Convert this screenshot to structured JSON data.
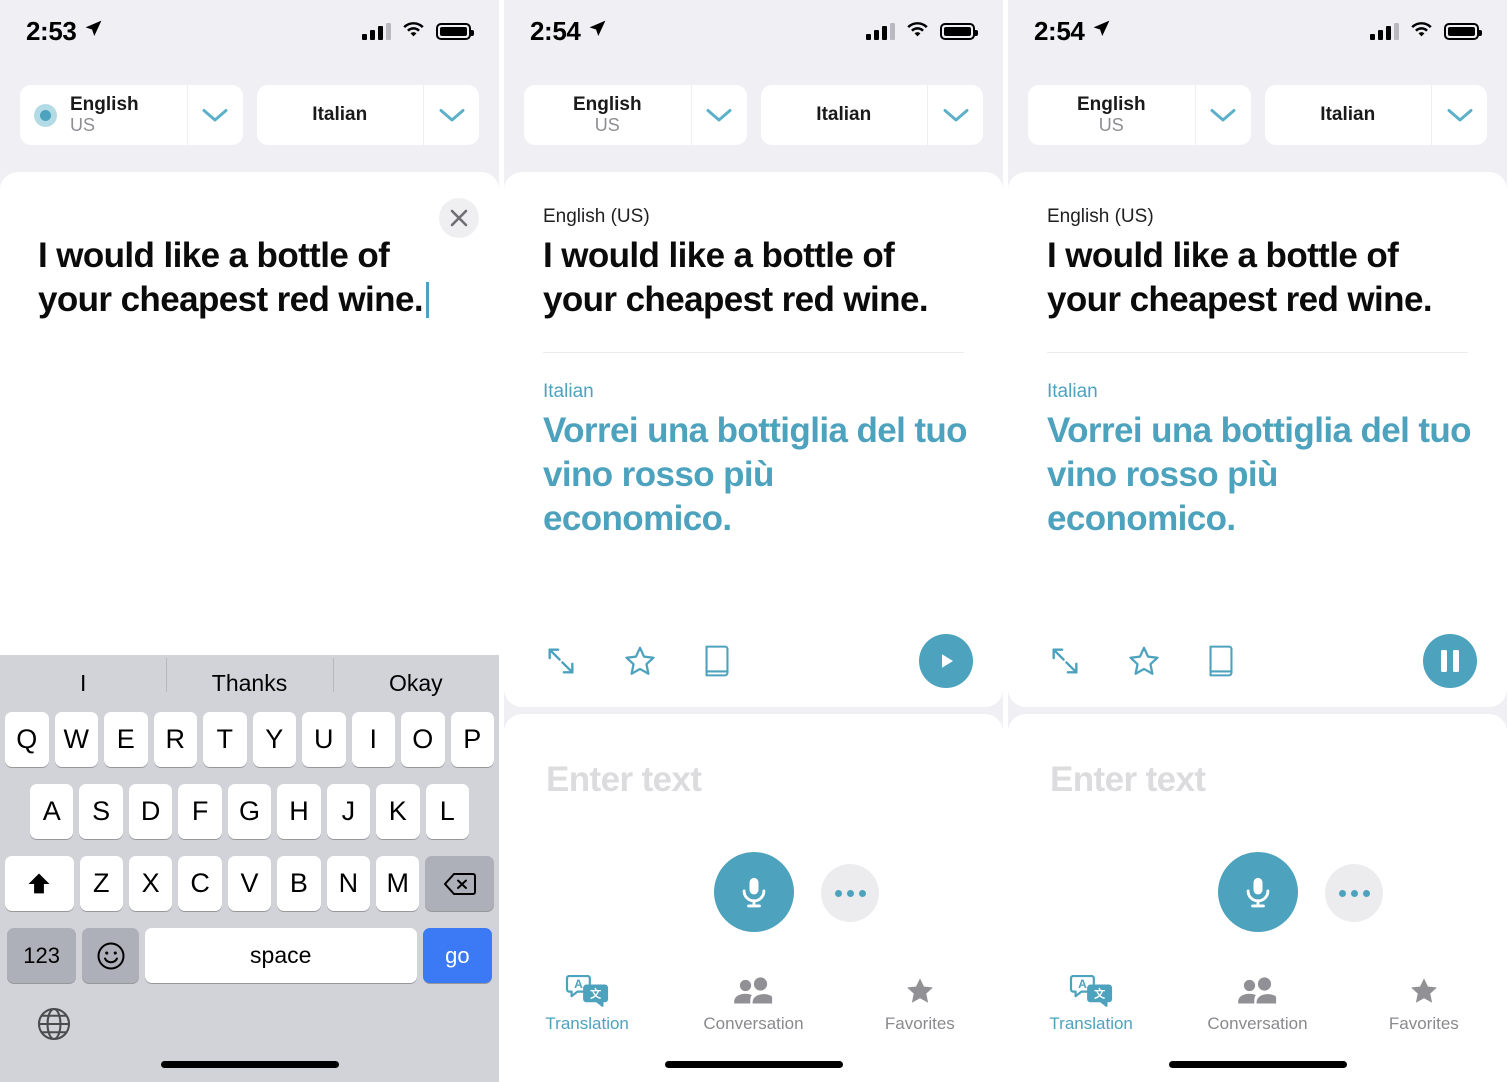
{
  "accent": "#4da2bd",
  "blue": "#3b79f5",
  "screens": [
    {
      "id": "compose",
      "status": {
        "time": "2:53",
        "location_icon": "location-arrow-icon",
        "signal_icon": "cellular-signal-icon",
        "wifi_icon": "wifi-icon",
        "battery_icon": "battery-full-icon"
      },
      "langbar": {
        "source": {
          "name": "English",
          "sub": "US",
          "selected": true
        },
        "target": {
          "name": "Italian",
          "sub": ""
        },
        "chevron_icon": "chevron-down-icon"
      },
      "card": {
        "close_icon": "close-icon",
        "text": "I would like a bottle of your cheapest red wine."
      },
      "keyboard": {
        "suggestions": [
          "I",
          "Thanks",
          "Okay"
        ],
        "row1": [
          "Q",
          "W",
          "E",
          "R",
          "T",
          "Y",
          "U",
          "I",
          "O",
          "P"
        ],
        "row2": [
          "A",
          "S",
          "D",
          "F",
          "G",
          "H",
          "J",
          "K",
          "L"
        ],
        "row3": [
          "Z",
          "X",
          "C",
          "V",
          "B",
          "N",
          "M"
        ],
        "shift_label": "shift-icon",
        "backspace_label": "backspace-icon",
        "numbers_label": "123",
        "emoji_label": "emoji-icon",
        "space_label": "space",
        "go_label": "go",
        "globe_label": "globe-icon"
      }
    },
    {
      "id": "translated",
      "status": {
        "time": "2:54",
        "location_icon": "location-arrow-icon",
        "signal_icon": "cellular-signal-icon",
        "wifi_icon": "wifi-icon",
        "battery_icon": "battery-full-icon"
      },
      "langbar": {
        "source": {
          "name": "English",
          "sub": "US",
          "selected": false
        },
        "target": {
          "name": "Italian",
          "sub": ""
        },
        "chevron_icon": "chevron-down-icon"
      },
      "result": {
        "source_label": "English (US)",
        "source_text": "I would like a bottle of your cheapest red wine.",
        "target_label": "Italian",
        "target_text": "Vorrei una bottiglia del tuo vino rosso più economico.",
        "actions": {
          "expand_icon": "expand-arrows-icon",
          "favorite_icon": "star-outline-icon",
          "dictionary_icon": "book-icon",
          "play_icon": "play-icon",
          "play_state": "play"
        }
      },
      "input": {
        "placeholder": "Enter text",
        "mic_icon": "microphone-icon",
        "more_icon": "ellipsis-icon"
      },
      "tabbar": [
        {
          "label": "Translation",
          "icon": "translation-bubbles-icon",
          "active": true
        },
        {
          "label": "Conversation",
          "icon": "people-icon",
          "active": false
        },
        {
          "label": "Favorites",
          "icon": "star-filled-icon",
          "active": false
        }
      ]
    },
    {
      "id": "playing",
      "status": {
        "time": "2:54",
        "location_icon": "location-arrow-icon",
        "signal_icon": "cellular-signal-icon",
        "wifi_icon": "wifi-icon",
        "battery_icon": "battery-full-icon"
      },
      "langbar": {
        "source": {
          "name": "English",
          "sub": "US",
          "selected": false
        },
        "target": {
          "name": "Italian",
          "sub": ""
        },
        "chevron_icon": "chevron-down-icon"
      },
      "result": {
        "source_label": "English (US)",
        "source_text": "I would like a bottle of your cheapest red wine.",
        "target_label": "Italian",
        "target_text": "Vorrei una bottiglia del tuo vino rosso più economico.",
        "actions": {
          "expand_icon": "expand-arrows-icon",
          "favorite_icon": "star-outline-icon",
          "dictionary_icon": "book-icon",
          "play_icon": "pause-icon",
          "play_state": "pause"
        }
      },
      "input": {
        "placeholder": "Enter text",
        "mic_icon": "microphone-icon",
        "more_icon": "ellipsis-icon"
      },
      "tabbar": [
        {
          "label": "Translation",
          "icon": "translation-bubbles-icon",
          "active": true
        },
        {
          "label": "Conversation",
          "icon": "people-icon",
          "active": false
        },
        {
          "label": "Favorites",
          "icon": "star-filled-icon",
          "active": false
        }
      ]
    }
  ]
}
